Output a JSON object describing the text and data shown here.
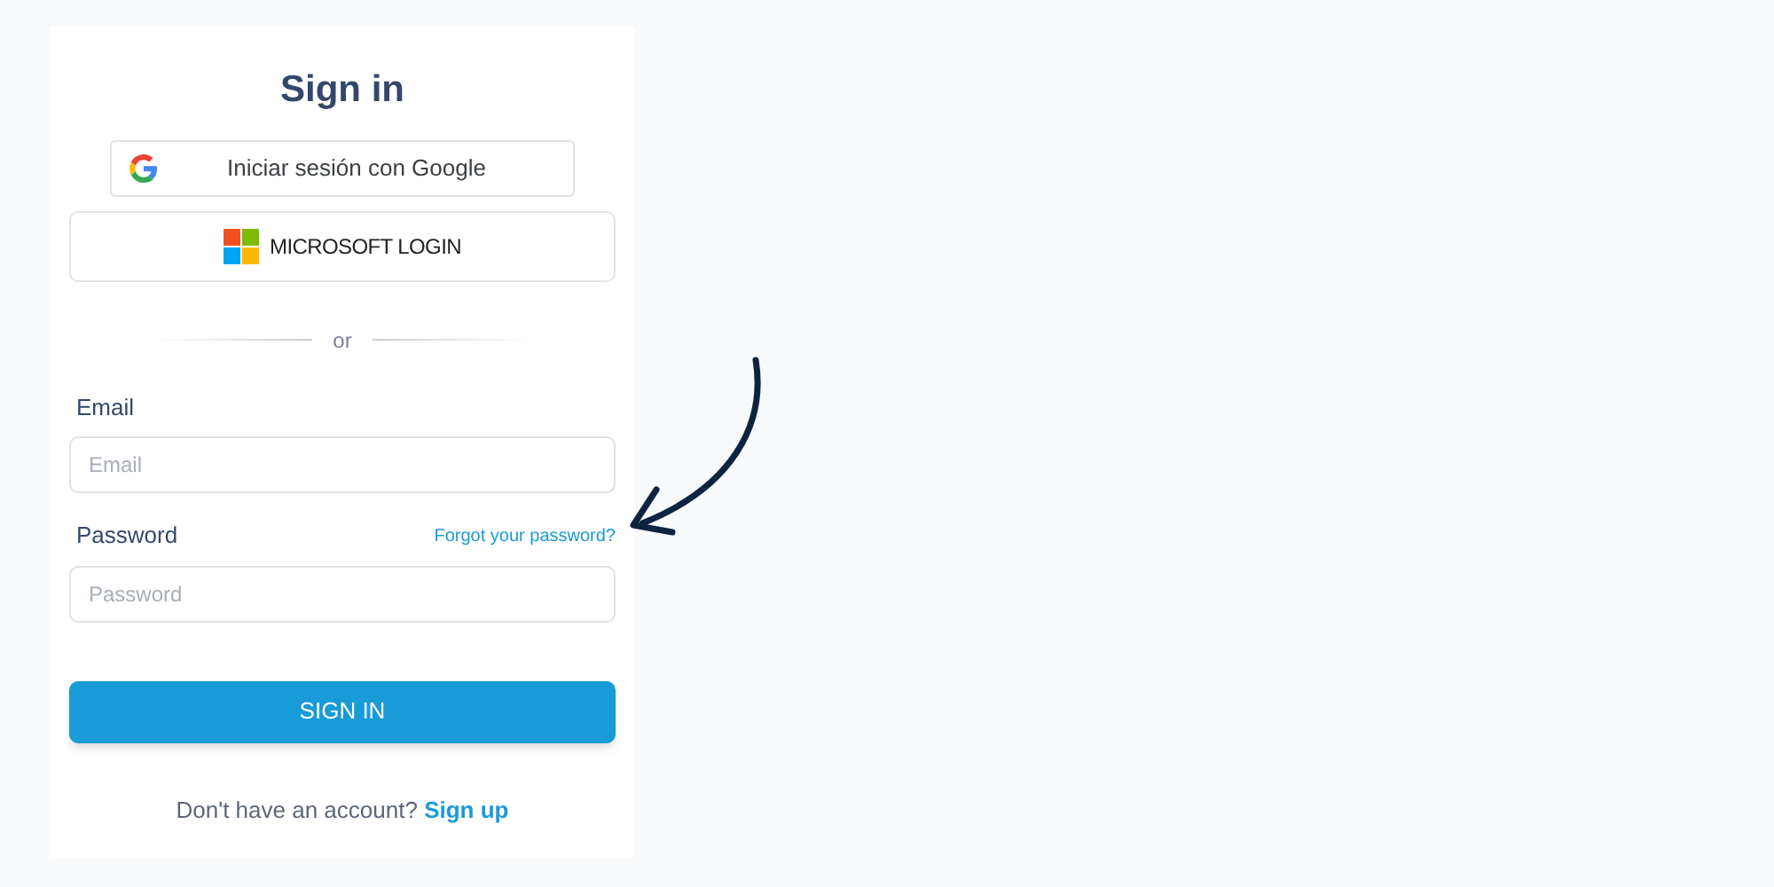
{
  "title": "Sign in",
  "social_buttons": [
    {
      "kind": "google",
      "label": "Iniciar sesión con Google"
    },
    {
      "kind": "microsoft",
      "label": "MICROSOFT LOGIN"
    }
  ],
  "divider": "or",
  "email": {
    "label": "Email",
    "placeholder": "Email"
  },
  "password": {
    "label": "Password",
    "placeholder": "Password",
    "forgot_link": "Forgot your password?"
  },
  "submit": "SIGN IN",
  "signup": {
    "text": "Don't have an account?",
    "link": "Sign up"
  }
}
